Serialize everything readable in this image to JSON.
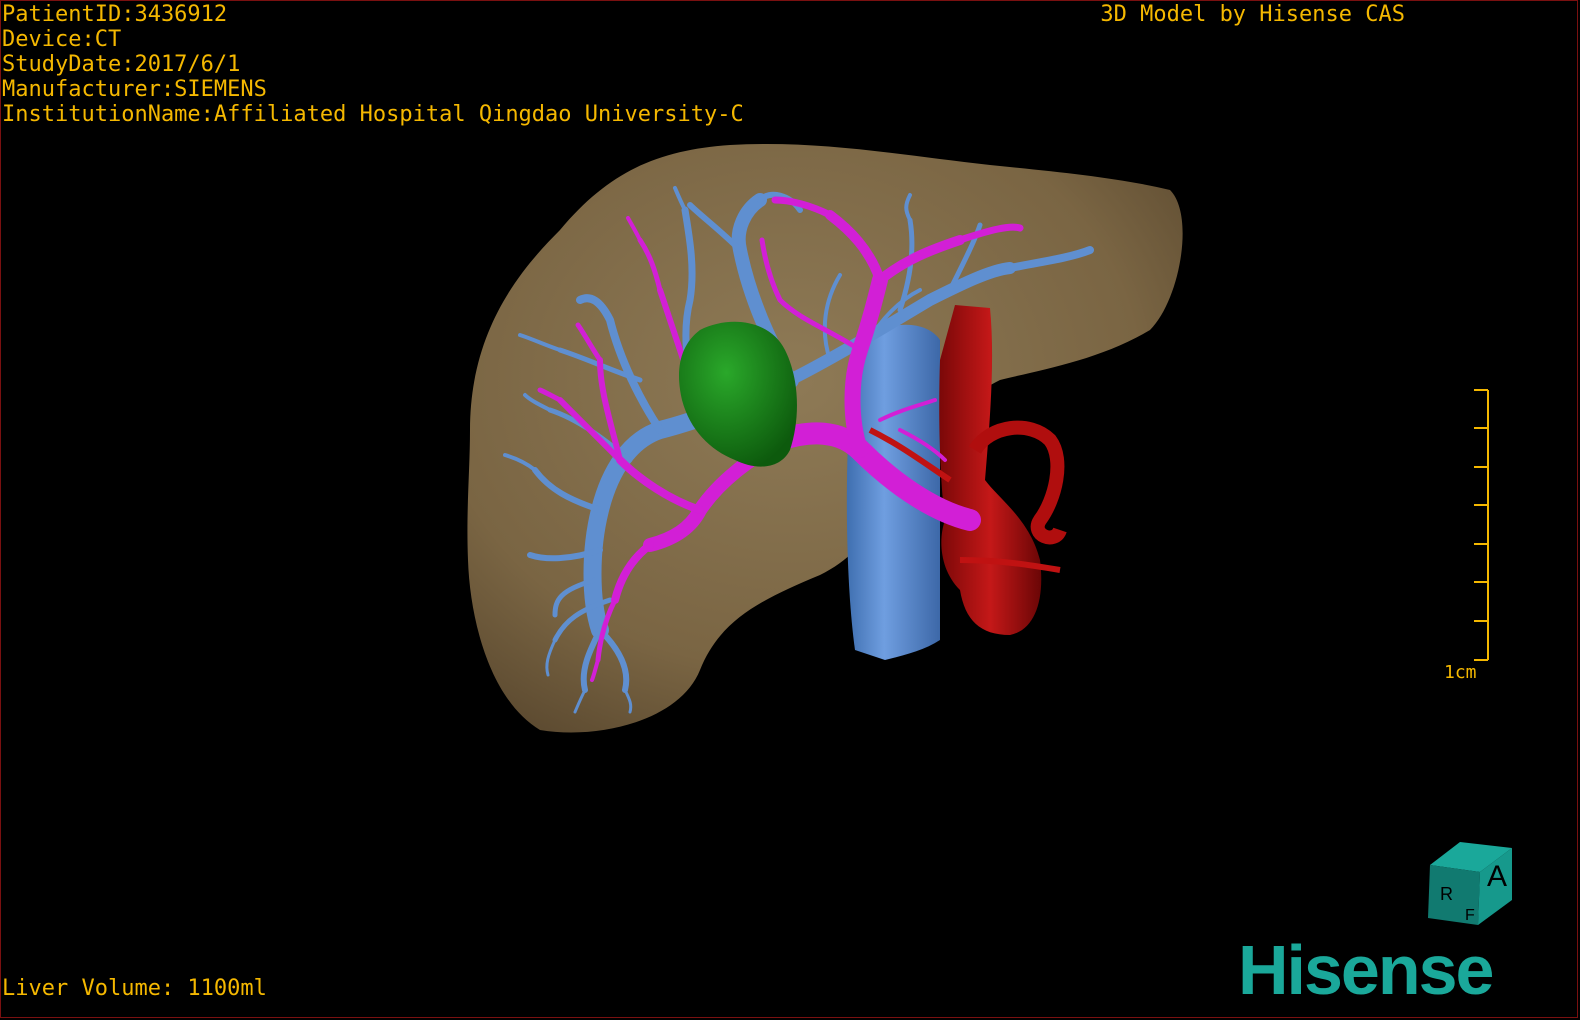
{
  "header": {
    "patient_id": "PatientID:3436912",
    "device": "Device:CT",
    "study_date": "StudyDate:2017/6/1",
    "manufacturer": "Manufacturer:SIEMENS",
    "institution": "InstitutionName:Affiliated Hospital Qingdao University-C",
    "credit": "3D Model by Hisense CAS"
  },
  "footer": {
    "liver_volume": "Liver Volume: 1100ml",
    "brand": "Hisense"
  },
  "scale_bar": {
    "label": "1cm"
  },
  "orientation_cube": {
    "front": "A",
    "side": "R",
    "top": "F"
  },
  "colors": {
    "text": "#f5b800",
    "liver": "#8a7350",
    "portal_vein": "#5f8fd0",
    "hepatic_vein": "#d21fd6",
    "tumor": "#1a7a1a",
    "artery": "#b00e0e",
    "brand": "#1aa89a"
  }
}
